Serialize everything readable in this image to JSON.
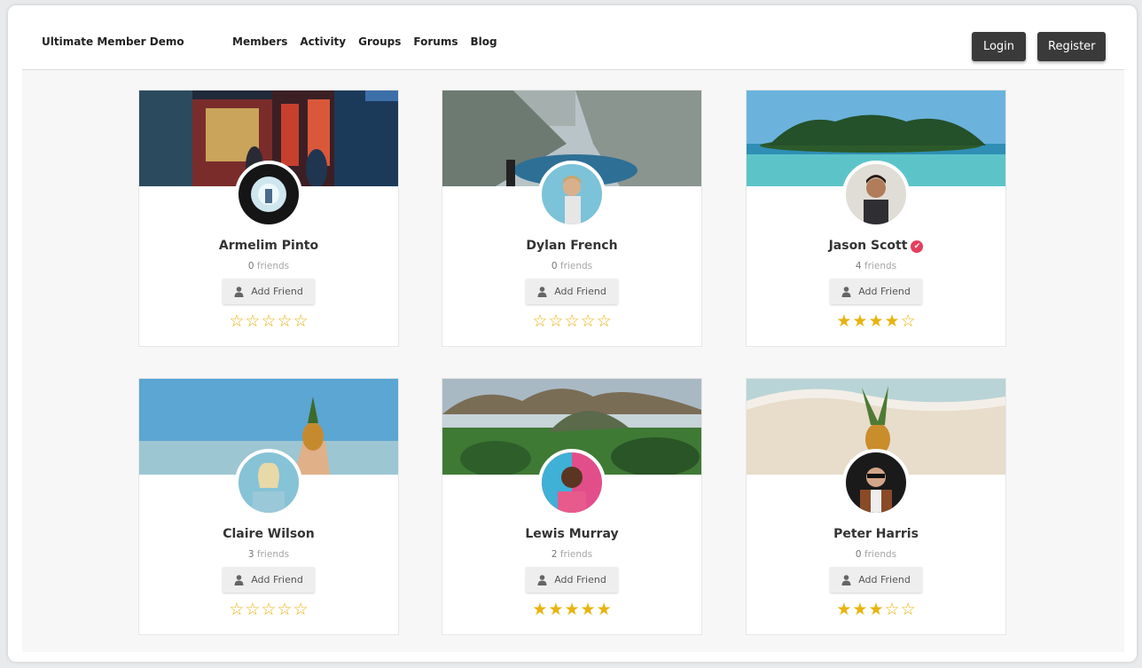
{
  "header": {
    "site_title": "Ultimate Member Demo",
    "menu": [
      "Members",
      "Activity",
      "Groups",
      "Forums",
      "Blog"
    ],
    "login_label": "Login",
    "register_label": "Register"
  },
  "friends_word": "friends",
  "add_friend_label": "Add Friend",
  "accent_star_color": "#e8b30f",
  "verified_color": "#e53d5e",
  "members": [
    {
      "name": "Armelim Pinto",
      "friends": "0",
      "rating": 0,
      "verified": false
    },
    {
      "name": "Dylan French",
      "friends": "0",
      "rating": 0,
      "verified": false
    },
    {
      "name": "Jason Scott",
      "friends": "4",
      "rating": 4,
      "verified": true
    },
    {
      "name": "Claire Wilson",
      "friends": "3",
      "rating": 0,
      "verified": false
    },
    {
      "name": "Lewis Murray",
      "friends": "2",
      "rating": 5,
      "verified": false
    },
    {
      "name": "Peter Harris",
      "friends": "0",
      "rating": 3,
      "verified": false
    }
  ]
}
